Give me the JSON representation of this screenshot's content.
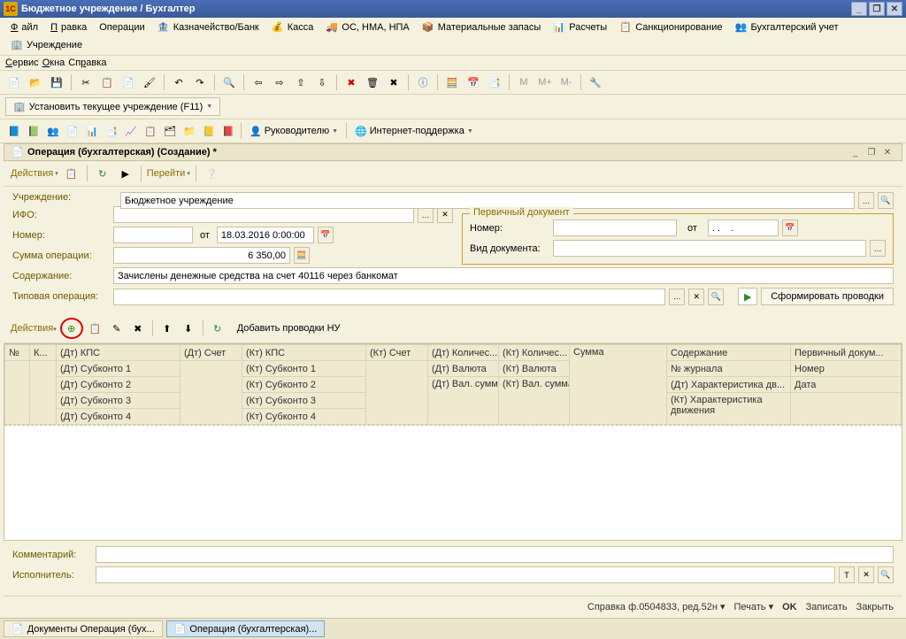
{
  "title": "Бюджетное учреждение / Бухгалтер",
  "menu": {
    "file": "Файл",
    "edit": "Правка",
    "ops": "Операции",
    "treasury": "Казначейство/Банк",
    "kassa": "Касса",
    "os": "ОС, НМА, НПА",
    "mat": "Материальные запасы",
    "calc": "Расчеты",
    "sank": "Санкционирование",
    "buh": "Бухгалтерский учет",
    "uchr": "Учреждение",
    "service": "Сервис",
    "windows": "Окна",
    "help": "Справка"
  },
  "tb": {
    "set_current": "Установить текущее учреждение (F11)"
  },
  "tb3": {
    "ruk": "Руководителю",
    "inet": "Интернет-поддержка"
  },
  "doc": {
    "title": "Операция (бухгалтерская) (Создание) *"
  },
  "action": {
    "actions": "Действия",
    "goto": "Перейти"
  },
  "labels": {
    "uchr": "Учреждение:",
    "ifo": "ИФО:",
    "nomer": "Номер:",
    "ot": "от",
    "sum": "Сумма операции:",
    "content": "Содержание:",
    "typ": "Типовая операция:",
    "pd": "Первичный документ",
    "pd_nomer": "Номер:",
    "pd_ot": "от",
    "pd_vid": "Вид документа:",
    "comment": "Комментарий:",
    "isp": "Исполнитель:"
  },
  "values": {
    "uchr": "Бюджетное учреждение",
    "date": "18.03.2016 0:00:00",
    "sum": "6 350,00",
    "content": "Зачислены денежные средства на счет 40116 через банкомат",
    "pd_date": ". .    ."
  },
  "tab": {
    "actions": "Действия",
    "addnpu": "Добавить проводки НУ"
  },
  "grid": {
    "h": [
      "№",
      "К...",
      "(Дт) КПС",
      "(Дт) Счет",
      "(Кт) КПС",
      "(Кт) Счет",
      "(Дт) Количес...",
      "(Кт) Количес...",
      "Сумма",
      "Содержание",
      "Первичный докум..."
    ],
    "r2": [
      "",
      "",
      "(Дт) Субконто 1",
      "",
      "(Кт) Субконто 1",
      "",
      "(Дт) Валюта",
      "(Кт) Валюта",
      "",
      "№ журнала",
      "Номер"
    ],
    "r3": [
      "",
      "",
      "(Дт) Субконто 2",
      "",
      "(Кт) Субконто 2",
      "",
      "(Дт) Вал. сумма",
      "(Кт) Вал. сумма",
      "",
      "(Дт) Характеристика дв...",
      "Дата"
    ],
    "r4": [
      "",
      "",
      "(Дт) Субконто 3",
      "",
      "(Кт) Субконто 3",
      "",
      "",
      "",
      "",
      "(Кт) Характеристика движения",
      ""
    ],
    "r5": [
      "",
      "",
      "(Дт) Субконто 4",
      "",
      "(Кт) Субконто 4",
      "",
      "",
      "",
      "",
      "",
      ""
    ]
  },
  "formbtn": "Сформировать проводки",
  "bottom": {
    "spravka": "Справка ф.0504833, ред.52н",
    "print": "Печать",
    "ok": "OK",
    "save": "Записать",
    "close": "Закрыть"
  },
  "tasks": {
    "t1": "Документы Операция (бух...",
    "t2": "Операция (бухгалтерская)..."
  }
}
